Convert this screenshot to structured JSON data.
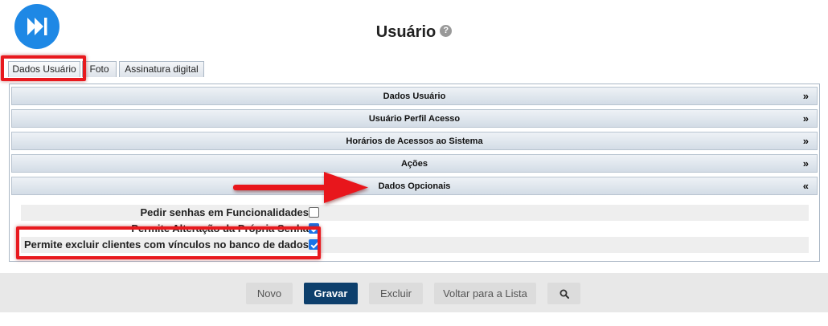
{
  "header": {
    "title": "Usuário",
    "help_glyph": "?",
    "logo_icon": "fast-forward-icon",
    "logo_color": "#1e88e5"
  },
  "tabs": [
    {
      "label": "Dados Usuário",
      "active": true
    },
    {
      "label": "Foto",
      "active": false
    },
    {
      "label": "Assinatura digital",
      "active": false
    }
  ],
  "accordion": [
    {
      "label": "Dados Usuário",
      "chevron": "»",
      "expanded": false
    },
    {
      "label": "Usuário Perfil Acesso",
      "chevron": "»",
      "expanded": false
    },
    {
      "label": "Horários de Acessos ao Sistema",
      "chevron": "»",
      "expanded": false
    },
    {
      "label": "Ações",
      "chevron": "»",
      "expanded": false
    },
    {
      "label": "Dados Opcionais",
      "chevron": "«",
      "expanded": true
    }
  ],
  "options": [
    {
      "label": "Pedir senhas em Funcionalidades",
      "checked": false
    },
    {
      "label": "Permite Alteração da Própria Senha",
      "checked": true
    },
    {
      "label": "Permite excluir clientes com vínculos no banco de dados",
      "checked": true
    }
  ],
  "footer": {
    "novo": "Novo",
    "gravar": "Gravar",
    "excluir": "Excluir",
    "voltar": "Voltar para a Lista",
    "search_icon": "search-icon"
  },
  "colors": {
    "primary_button": "#0d3f6c",
    "annotation_red": "#e8191e",
    "checkbox_blue": "#1a73e8"
  }
}
